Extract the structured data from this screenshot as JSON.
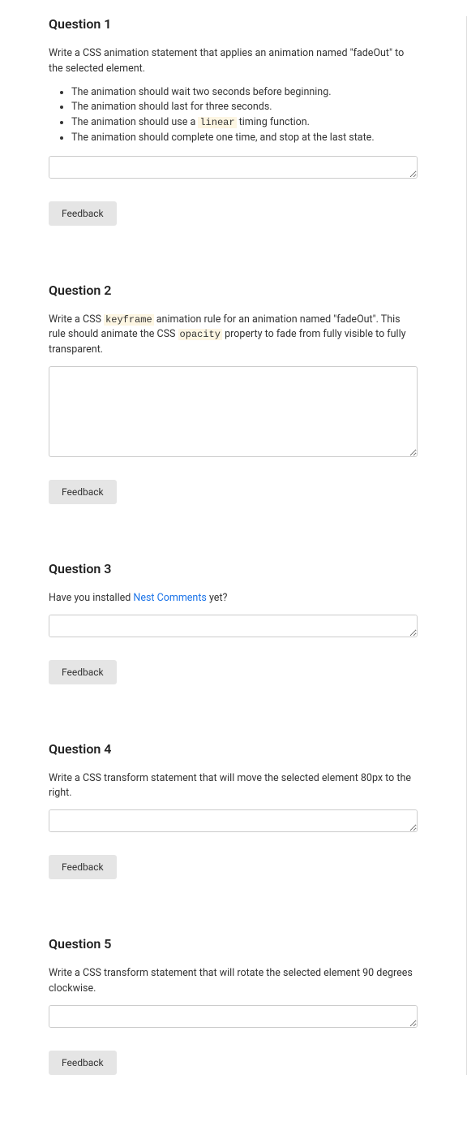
{
  "questions": [
    {
      "title": "Question 1",
      "prompt_pre": "Write a CSS animation statement that applies an animation named \"fadeOut\" to the selected element.",
      "bullets": [
        {
          "pre": "The animation should wait two seconds before beginning."
        },
        {
          "pre": "The animation should last for three seconds."
        },
        {
          "pre": "The animation should use a ",
          "code": "linear",
          "post": " timing function."
        },
        {
          "pre": "The animation should complete one time, and stop at the last state."
        }
      ],
      "textarea_size": "small",
      "feedback_label": "Feedback"
    },
    {
      "title": "Question 2",
      "prompt_parts": {
        "p1": "Write a CSS ",
        "c1": "keyframe",
        "p2": " animation rule for an animation named \"fadeOut\". This rule should animate the CSS ",
        "c2": "opacity",
        "p3": " property to fade from fully visible to fully transparent."
      },
      "textarea_size": "large",
      "feedback_label": "Feedback"
    },
    {
      "title": "Question 3",
      "prompt_parts": {
        "p1": "Have you installed ",
        "link": "Nest Comments",
        "p2": " yet?"
      },
      "textarea_size": "small",
      "feedback_label": "Feedback"
    },
    {
      "title": "Question 4",
      "prompt_pre": "Write a CSS transform statement that will move the selected element 80px to the right.",
      "textarea_size": "small",
      "feedback_label": "Feedback"
    },
    {
      "title": "Question 5",
      "prompt_pre": "Write a CSS transform statement that will rotate the selected element 90 degrees clockwise.",
      "textarea_size": "small",
      "feedback_label": "Feedback"
    }
  ]
}
